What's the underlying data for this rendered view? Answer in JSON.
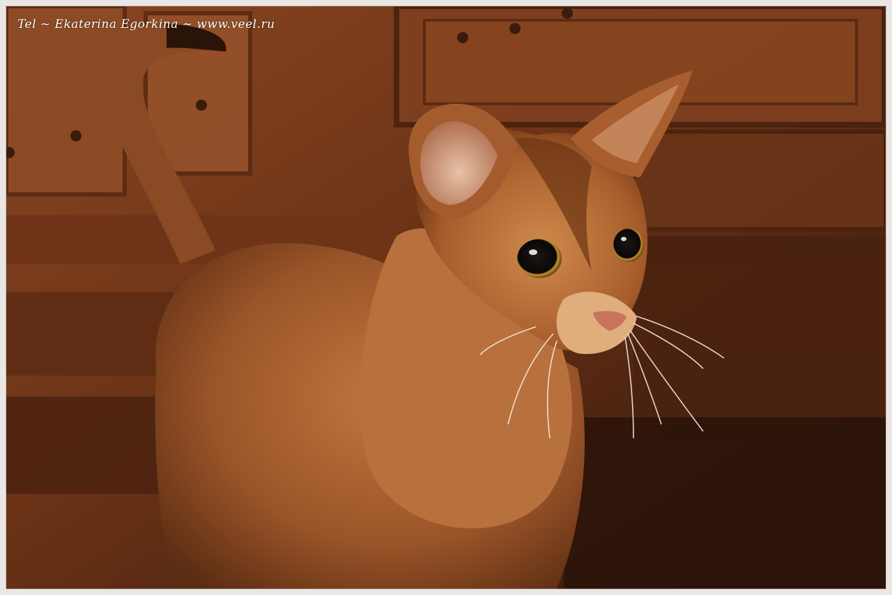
{
  "photo": {
    "subject": "cat-icon",
    "watermark": "Tel ~ Ekaterina Egorkina ~ www.veel.ru"
  },
  "colors": {
    "frame": "#e9e6e3",
    "wood_dark": "#3a1c0c",
    "wood_mid": "#7a3d1c",
    "wood_light": "#a65a2c",
    "fur": "#b26a36",
    "fur_light": "#d49a64",
    "eye": "#0c0a08",
    "iris_ring": "#d8a33a"
  }
}
